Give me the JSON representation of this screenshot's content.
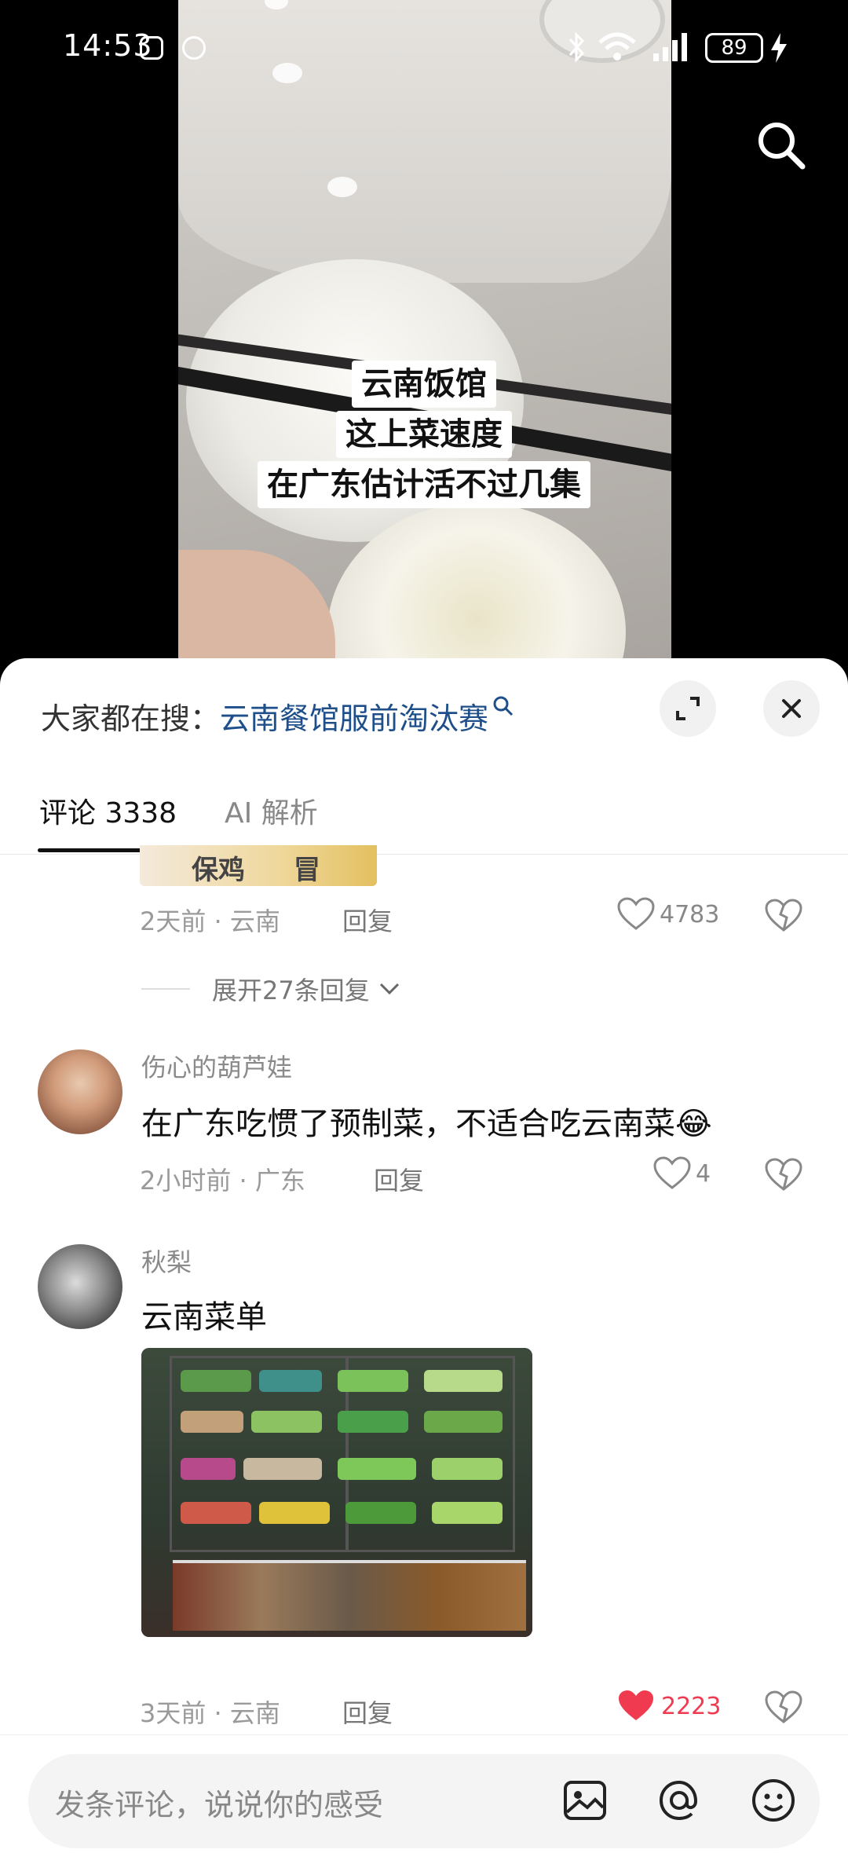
{
  "status_bar": {
    "time": "14:53",
    "battery": "89"
  },
  "video": {
    "caption_lines": [
      "云南饭馆",
      "这上菜速度",
      "在广东估计活不过几集"
    ]
  },
  "sheet": {
    "hot_search_prefix": "大家都在搜：",
    "hot_search_keyword": "云南餐馆服前淘汰赛",
    "tabs": {
      "comments": "评论 3338",
      "ai": "AI 解析"
    },
    "partial_image_text_left": "保鸡",
    "partial_image_text_right": "冒",
    "first": {
      "meta": "2天前 · 云南",
      "reply": "回复",
      "likes": "4783"
    },
    "expand_replies": "展开27条回复",
    "comments": [
      {
        "user": "伤心的葫芦娃",
        "text": "在广东吃惯了预制菜，不适合吃云南菜",
        "emoji": "😂",
        "meta": "2小时前 · 广东",
        "reply": "回复",
        "likes": "4",
        "liked": false
      },
      {
        "user": "秋梨",
        "text": "云南菜单",
        "meta": "3天前 · 云南",
        "reply": "回复",
        "likes": "2223",
        "liked": true
      }
    ]
  },
  "input": {
    "placeholder": "发条评论，说说你的感受"
  },
  "colors": {
    "liked_heart": "#f03a4f",
    "keyword": "#1e4f8a"
  }
}
